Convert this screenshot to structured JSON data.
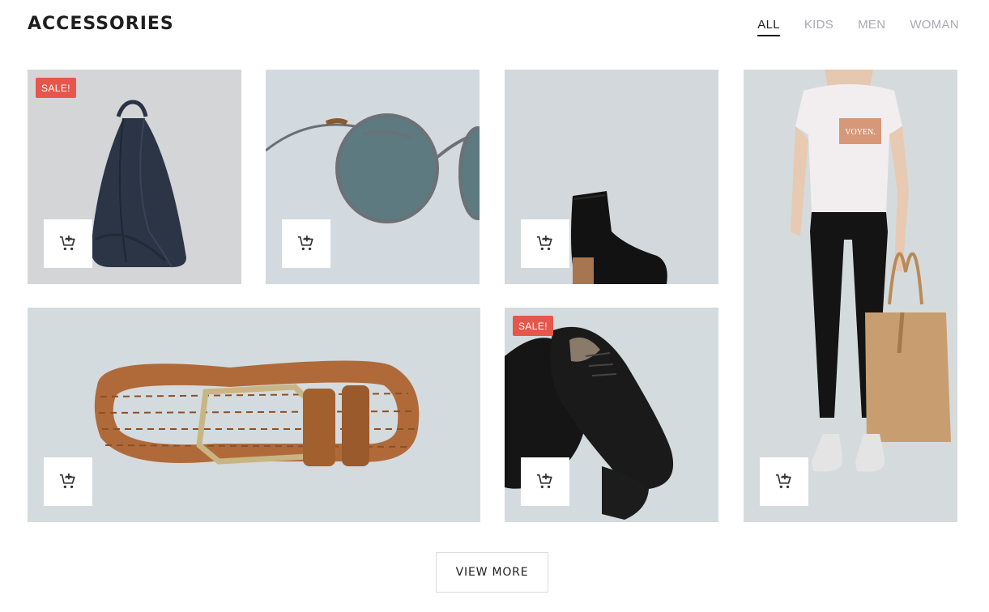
{
  "header": {
    "title": "ACCESSORIES",
    "filters": [
      {
        "label": "ALL",
        "active": true
      },
      {
        "label": "KIDS",
        "active": false
      },
      {
        "label": "MEN",
        "active": false
      },
      {
        "label": "WOMAN",
        "active": false
      }
    ]
  },
  "products": [
    {
      "name": "backpack",
      "sale_label": "SALE!",
      "image_icon": "backpack-image",
      "cart_icon": "add-to-cart-icon"
    },
    {
      "name": "sunglasses",
      "sale_label": null,
      "image_icon": "sunglasses-image",
      "cart_icon": "add-to-cart-icon"
    },
    {
      "name": "ankle-boot",
      "sale_label": null,
      "image_icon": "boot-image",
      "cart_icon": "add-to-cart-icon"
    },
    {
      "name": "model-tote",
      "sale_label": null,
      "image_icon": "model-with-tote-bag-image",
      "printed_text": "VOYEN.",
      "cart_icon": "add-to-cart-icon"
    },
    {
      "name": "belt",
      "sale_label": null,
      "image_icon": "braided-belt-image",
      "cart_icon": "add-to-cart-icon"
    },
    {
      "name": "oxford-shoes",
      "sale_label": "SALE!",
      "image_icon": "oxford-shoes-image",
      "cart_icon": "add-to-cart-icon"
    }
  ],
  "footer": {
    "view_more_label": "VIEW MORE"
  },
  "colors": {
    "sale_badge": "#e7564b",
    "text_dark": "#1e1e1e",
    "filter_inactive": "#a9aab0"
  }
}
